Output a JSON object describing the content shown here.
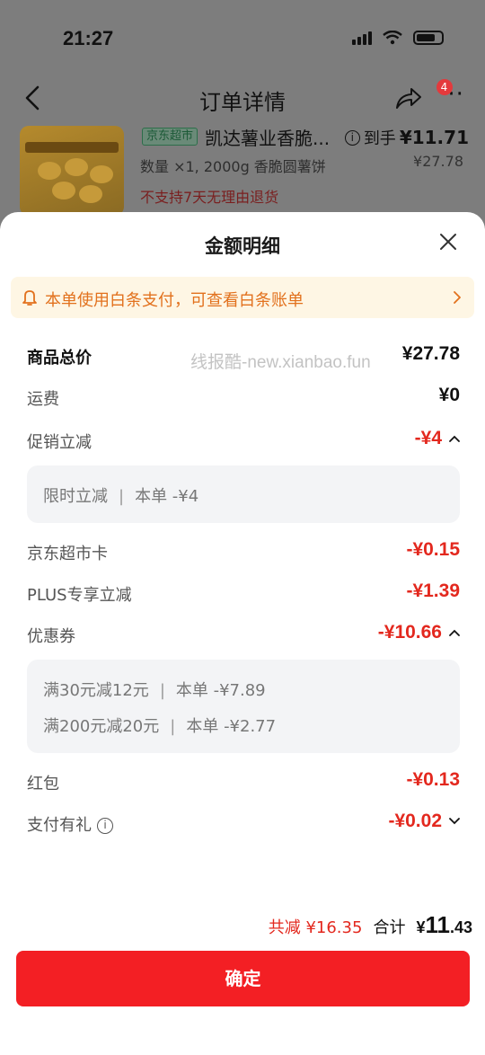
{
  "status_bar": {
    "time": "21:27"
  },
  "nav": {
    "title": "订单详情",
    "more_badge": "4"
  },
  "product": {
    "store_tag": "京东超市",
    "name": "凯达薯业香脆...",
    "spec": "数量 ×1, 2000g 香脆圆薯饼",
    "return_policy": "不支持7天无理由退货",
    "final_price_label": "到手",
    "final_price": "¥11.71",
    "original_price": "¥27.78"
  },
  "sheet": {
    "title": "金额明细",
    "notice": "本单使用白条支付，可查看白条账单",
    "watermark": "线报酷-new.xianbao.fun",
    "rows": {
      "goods_total": {
        "label": "商品总价",
        "value": "¥27.78"
      },
      "shipping": {
        "label": "运费",
        "value": "¥0"
      },
      "promo": {
        "label": "促销立减",
        "value": "-¥4"
      },
      "supermarket_card": {
        "label": "京东超市卡",
        "value": "-¥0.15"
      },
      "plus": {
        "label": "PLUS专享立减",
        "value": "-¥1.39"
      },
      "coupon": {
        "label": "优惠券",
        "value": "-¥10.66"
      },
      "red_packet": {
        "label": "红包",
        "value": "-¥0.13"
      },
      "pay_gift": {
        "label": "支付有礼",
        "value": "-¥0.02"
      }
    },
    "promo_details": [
      {
        "name": "限时立减",
        "amount": "本单 -¥4"
      }
    ],
    "coupon_details": [
      {
        "name": "满30元减12元",
        "amount": "本单 -¥7.89"
      },
      {
        "name": "满200元减20元",
        "amount": "本单 -¥2.77"
      }
    ],
    "total": {
      "saved": "共减 ¥16.35",
      "label": "合计",
      "currency": "¥",
      "amount_int": "11",
      "amount_dec": ".43"
    },
    "confirm_label": "确定"
  },
  "colors": {
    "accent_red": "#f31f24",
    "discount_red": "#e3281e",
    "notice_orange": "#e2711d",
    "notice_bg": "#fef6e4"
  }
}
